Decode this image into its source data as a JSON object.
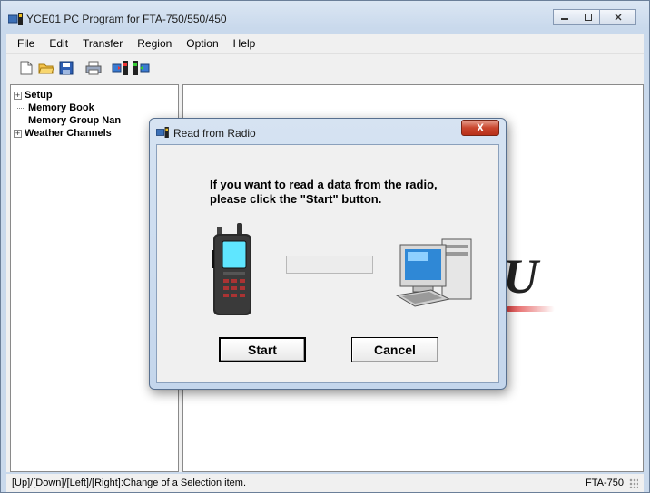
{
  "window": {
    "title": "YCE01 PC Program for FTA-750/550/450",
    "controls": {
      "minimize": "▭",
      "maximize": "▢",
      "close": "✕"
    }
  },
  "menu": [
    "File",
    "Edit",
    "Transfer",
    "Region",
    "Option",
    "Help"
  ],
  "toolbar": {
    "icons": [
      "new-file-icon",
      "open-folder-icon",
      "save-icon",
      "print-icon",
      "read-from-radio-icon",
      "write-to-radio-icon"
    ]
  },
  "tree": {
    "items": [
      {
        "label": "Setup",
        "expandable": true
      },
      {
        "label": "Memory Book",
        "expandable": false
      },
      {
        "label": "Memory Group Nan",
        "expandable": false
      },
      {
        "label": "Weather Channels",
        "expandable": true
      }
    ]
  },
  "dialog": {
    "title": "Read from Radio",
    "close_label": "X",
    "message_line1": "If you want to read a data from the radio,",
    "message_line2": "please click the \"Start\" button.",
    "progress": 0,
    "start_label": "Start",
    "cancel_label": "Cancel"
  },
  "status": {
    "hint": "[Up]/[Down]/[Left]/[Right]:Change of a Selection item.",
    "model": "FTA-750"
  },
  "colors": {
    "dialog_close": "#c9462e",
    "frame": "#c9d9ec",
    "logo_swoosh": "#e04040"
  }
}
